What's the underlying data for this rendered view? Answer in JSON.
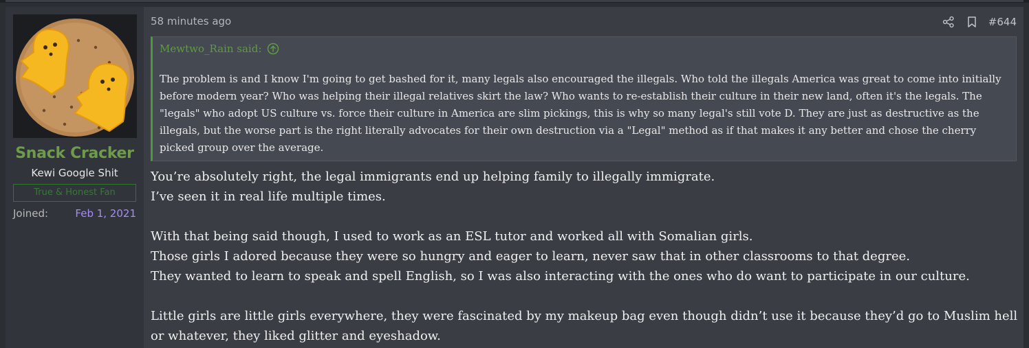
{
  "user": {
    "name": "Snack Cracker",
    "title": "Kewi Google Shit",
    "banner": "True & Honest Fan",
    "joined_label": "Joined:",
    "joined_value": "Feb 1, 2021",
    "avatar_icon": "crackers-with-cheese-ghosts-avatar"
  },
  "post": {
    "time": "58 minutes ago",
    "number": "#644",
    "share_icon": "share-icon",
    "bookmark_icon": "bookmark-icon"
  },
  "quote": {
    "author": "Mewtwo_Rain said:",
    "up_icon": "arrow-up-circle-icon",
    "text": "The problem is and I know I'm going to get bashed for it, many legals also encouraged the illegals. Who told the illegals America was great to come into initially before modern year? Who was helping their illegal relatives skirt the law? Who wants to re-establish their culture in their new land, often it's the legals. The \"legals\" who adopt US culture vs. force their culture in America are slim pickings, this is why so many legal's still vote D. They are just as destructive as the illegals, but the worse part is the right literally advocates for their own destruction via a \"Legal\" method as if that makes it any better and chose the cherry picked group over the average."
  },
  "content": {
    "lines": [
      "You’re absolutely right, the legal immigrants end up helping family to illegally immigrate.",
      "I’ve seen it in real life multiple times.",
      "With that being said though, I used to work as an ESL tutor and worked all with Somalian girls.",
      "Those girls I adored because they were so hungry and eager to learn, never saw that in other classrooms to that degree.",
      "They wanted to learn to speak and spell English, so I was also interacting with the ones who do want to participate in our culture.",
      "Little girls are little girls everywhere, they were fascinated by my makeup bag even though didn’t use it because they’d go to Muslim hell or whatever, they liked glitter and eyeshadow."
    ]
  },
  "colors": {
    "username": "#6e9b4c",
    "quote_accent": "#4d9a3a",
    "joined_date": "#a78bfa",
    "banner": "#2e7f2e"
  }
}
